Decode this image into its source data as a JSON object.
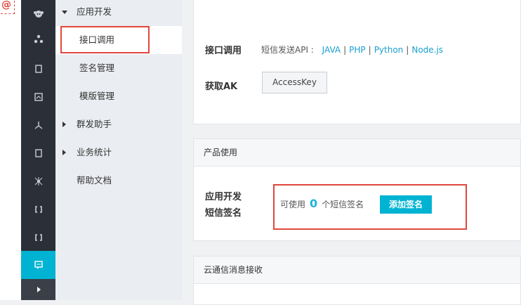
{
  "logo": {
    "text": "@"
  },
  "rail": {
    "icons": [
      "monkey-icon",
      "cluster-icon",
      "square-icon",
      "chart-icon",
      "network-icon",
      "square-icon-2",
      "node-icon",
      "link-icon",
      "link-icon-2",
      "message-icon",
      "expand-icon"
    ],
    "active_color": "#00b3d2"
  },
  "nav": {
    "group_app_dev": "应用开发",
    "item_api_call": "接口调用",
    "item_sign_mgmt": "签名管理",
    "item_template_mgmt": "模版管理",
    "group_bulk_send": "群发助手",
    "group_stats": "业务统计",
    "item_help_docs": "帮助文档"
  },
  "api_panel": {
    "api_label": "接口调用",
    "sms_api_prefix": "短信发送API :",
    "links": [
      "JAVA",
      "PHP",
      "Python",
      "Node.js"
    ],
    "separator": "|",
    "ak_label": "获取AK",
    "ak_button": "AccessKey"
  },
  "usage_panel": {
    "header": "产品使用",
    "label_line1": "应用开发",
    "label_line2": "短信签名",
    "available_prefix": "可使用",
    "count": "0",
    "count_suffix": "个短信签名",
    "add_button": "添加签名"
  },
  "msg_panel": {
    "header": "云通信消息接收"
  },
  "colors": {
    "accent": "#00b3d2",
    "highlight_border": "#e0473d",
    "link": "#1a9fd0"
  }
}
